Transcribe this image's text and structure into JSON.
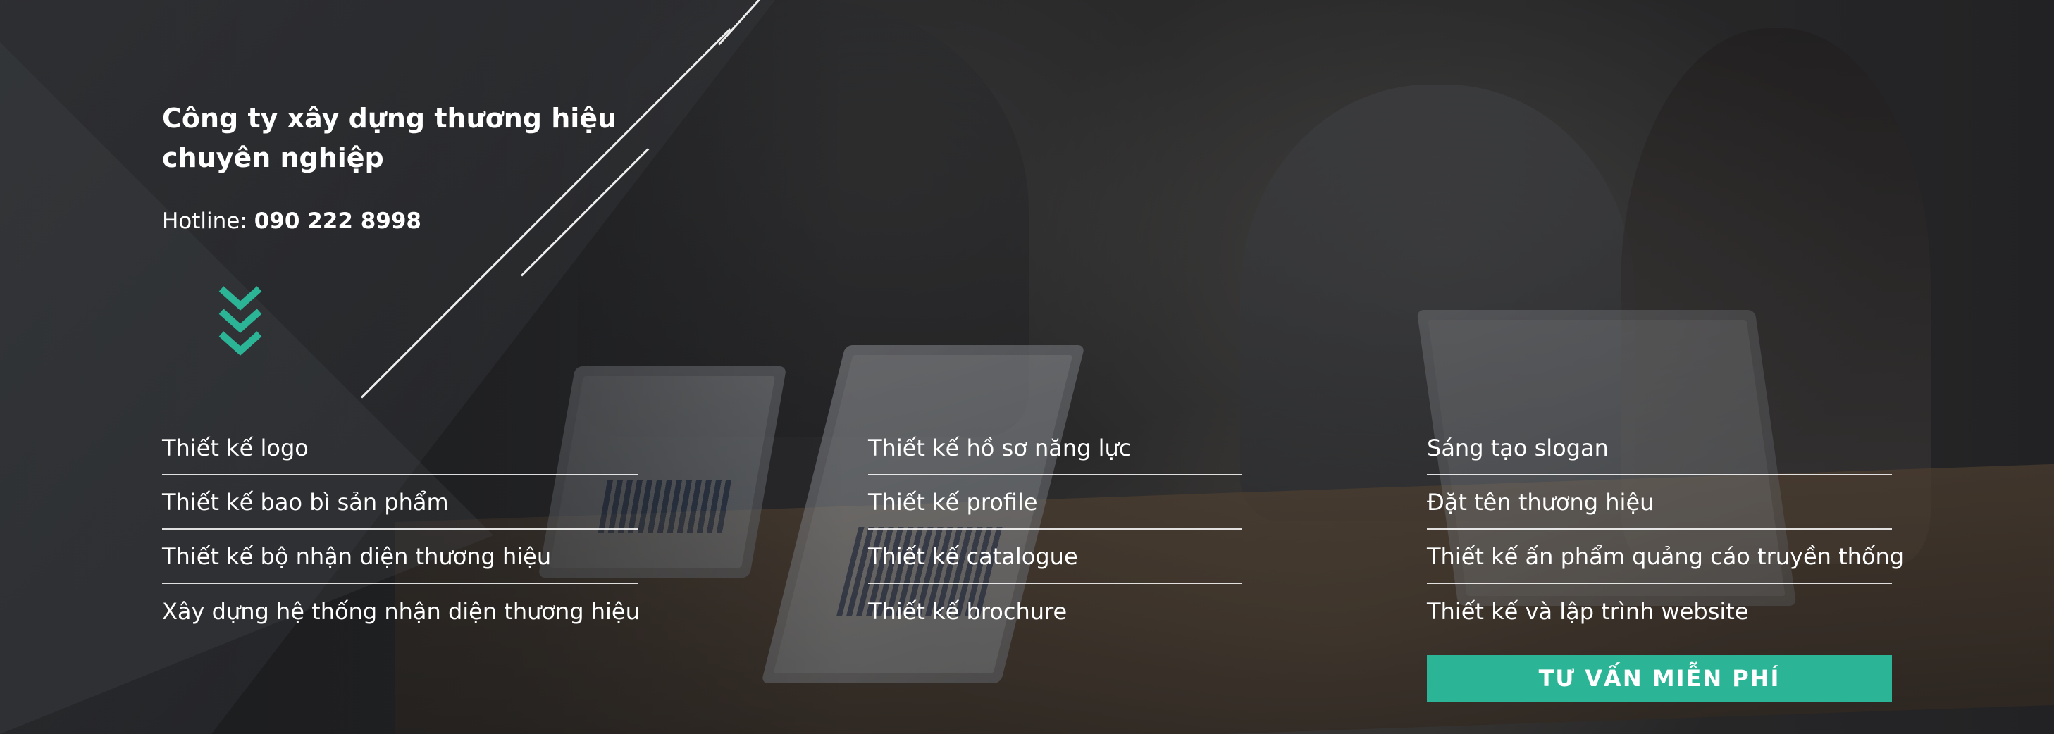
{
  "headline": {
    "line1": "Công ty xây dựng thương hiệu",
    "line2": "chuyên nghiệp"
  },
  "hotline": {
    "label": "Hotline: ",
    "number": "090 222 8998"
  },
  "services": {
    "column1": [
      "Thiết kế logo",
      "Thiết kế bao bì sản phẩm",
      "Thiết kế bộ nhận diện thương hiệu",
      "Xây dựng hệ thống nhận diện thương hiệu"
    ],
    "column2": [
      "Thiết kế hồ sơ năng lực",
      "Thiết kế profile",
      "Thiết kế catalogue",
      "Thiết kế brochure"
    ],
    "column3": [
      "Sáng tạo slogan",
      "Đặt tên thương hiệu",
      "Thiết kế ấn phẩm quảng cáo truyền thống",
      "Thiết kế và lập trình website"
    ]
  },
  "cta": {
    "label": "TƯ VẤN MIỄN PHÍ"
  },
  "colors": {
    "accent": "#2bb596",
    "text": "#ffffff",
    "overlay": "#1e1f21"
  },
  "icons": {
    "scroll_down": "triple-chevron-down-icon"
  }
}
